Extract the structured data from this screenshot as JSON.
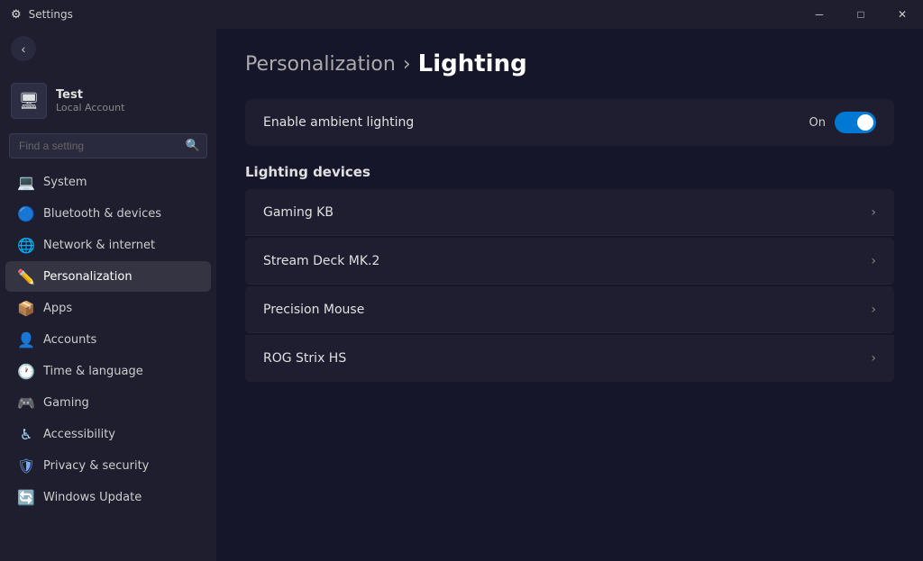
{
  "titlebar": {
    "title": "Settings",
    "min_btn": "─",
    "max_btn": "□",
    "close_btn": "✕"
  },
  "user": {
    "name": "Test",
    "account_type": "Local Account",
    "avatar_icon": "🖥"
  },
  "search": {
    "placeholder": "Find a setting"
  },
  "nav": {
    "items": [
      {
        "id": "system",
        "label": "System",
        "icon": "💻",
        "active": false
      },
      {
        "id": "bluetooth",
        "label": "Bluetooth & devices",
        "icon": "📶",
        "active": false
      },
      {
        "id": "network",
        "label": "Network & internet",
        "icon": "🌐",
        "active": false
      },
      {
        "id": "personalization",
        "label": "Personalization",
        "icon": "✏️",
        "active": true
      },
      {
        "id": "apps",
        "label": "Apps",
        "icon": "📦",
        "active": false
      },
      {
        "id": "accounts",
        "label": "Accounts",
        "icon": "👤",
        "active": false
      },
      {
        "id": "time",
        "label": "Time & language",
        "icon": "🕐",
        "active": false
      },
      {
        "id": "gaming",
        "label": "Gaming",
        "icon": "🎮",
        "active": false
      },
      {
        "id": "accessibility",
        "label": "Accessibility",
        "icon": "♿",
        "active": false
      },
      {
        "id": "privacy",
        "label": "Privacy & security",
        "icon": "🛡",
        "active": false
      },
      {
        "id": "update",
        "label": "Windows Update",
        "icon": "🔄",
        "active": false
      }
    ]
  },
  "content": {
    "breadcrumb_parent": "Personalization",
    "breadcrumb_separator": "›",
    "breadcrumb_current": "Lighting",
    "toggle_section": {
      "label": "Enable ambient lighting",
      "status": "On"
    },
    "devices_section": {
      "title": "Lighting devices",
      "items": [
        {
          "name": "Gaming KB"
        },
        {
          "name": "Stream Deck MK.2"
        },
        {
          "name": "Precision Mouse"
        },
        {
          "name": "ROG Strix HS"
        }
      ]
    }
  }
}
